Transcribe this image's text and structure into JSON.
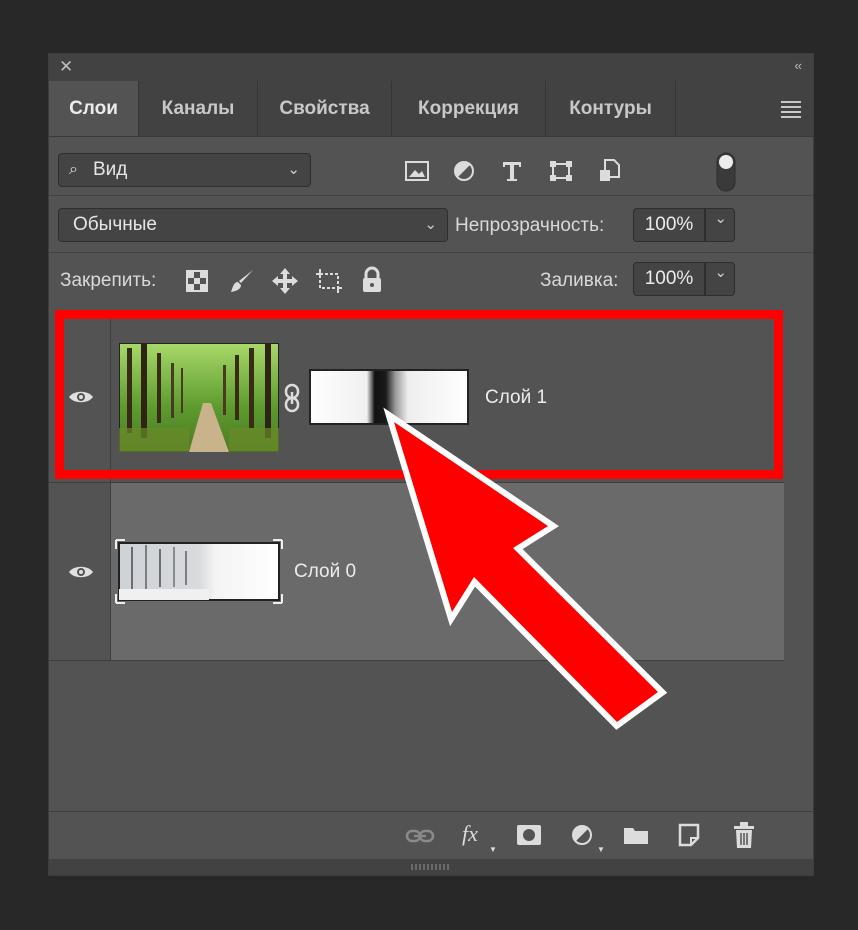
{
  "window": {
    "close_glyph": "✕",
    "collapse_glyph": "‹‹"
  },
  "tabs": [
    {
      "label": "Слои",
      "active": true
    },
    {
      "label": "Каналы",
      "active": false
    },
    {
      "label": "Свойства",
      "active": false
    },
    {
      "label": "Коррекция",
      "active": false
    },
    {
      "label": "Контуры",
      "active": false
    }
  ],
  "filter": {
    "label": "Вид",
    "icons": [
      "image-filter-icon",
      "adjustment-filter-icon",
      "type-filter-icon",
      "shape-filter-icon",
      "smart-object-filter-icon",
      "filter-toggle-icon"
    ]
  },
  "blend": {
    "mode": "Обычные",
    "opacity_label": "Непрозрачность:",
    "opacity_value": "100%"
  },
  "lock": {
    "label": "Закрепить:",
    "icons": [
      "lock-transparent-pixels-icon",
      "lock-image-pixels-icon",
      "lock-position-icon",
      "lock-artboard-icon",
      "lock-all-icon"
    ],
    "fill_label": "Заливка:",
    "fill_value": "100%"
  },
  "layers": [
    {
      "name": "Слой 1",
      "visible": true,
      "has_mask": true,
      "selected": false
    },
    {
      "name": "Слой 0",
      "visible": true,
      "has_mask": false,
      "selected": true
    }
  ],
  "footer": {
    "icons": [
      "link-layers-icon",
      "fx-icon",
      "add-mask-icon",
      "new-adjustment-layer-icon",
      "new-group-icon",
      "new-layer-icon",
      "delete-layer-icon"
    ],
    "fx_label": "fx"
  },
  "colors": {
    "panel": "#535353",
    "header": "#424242",
    "selected_layer": "#6a6a6a",
    "annotation": "#ff0000"
  }
}
